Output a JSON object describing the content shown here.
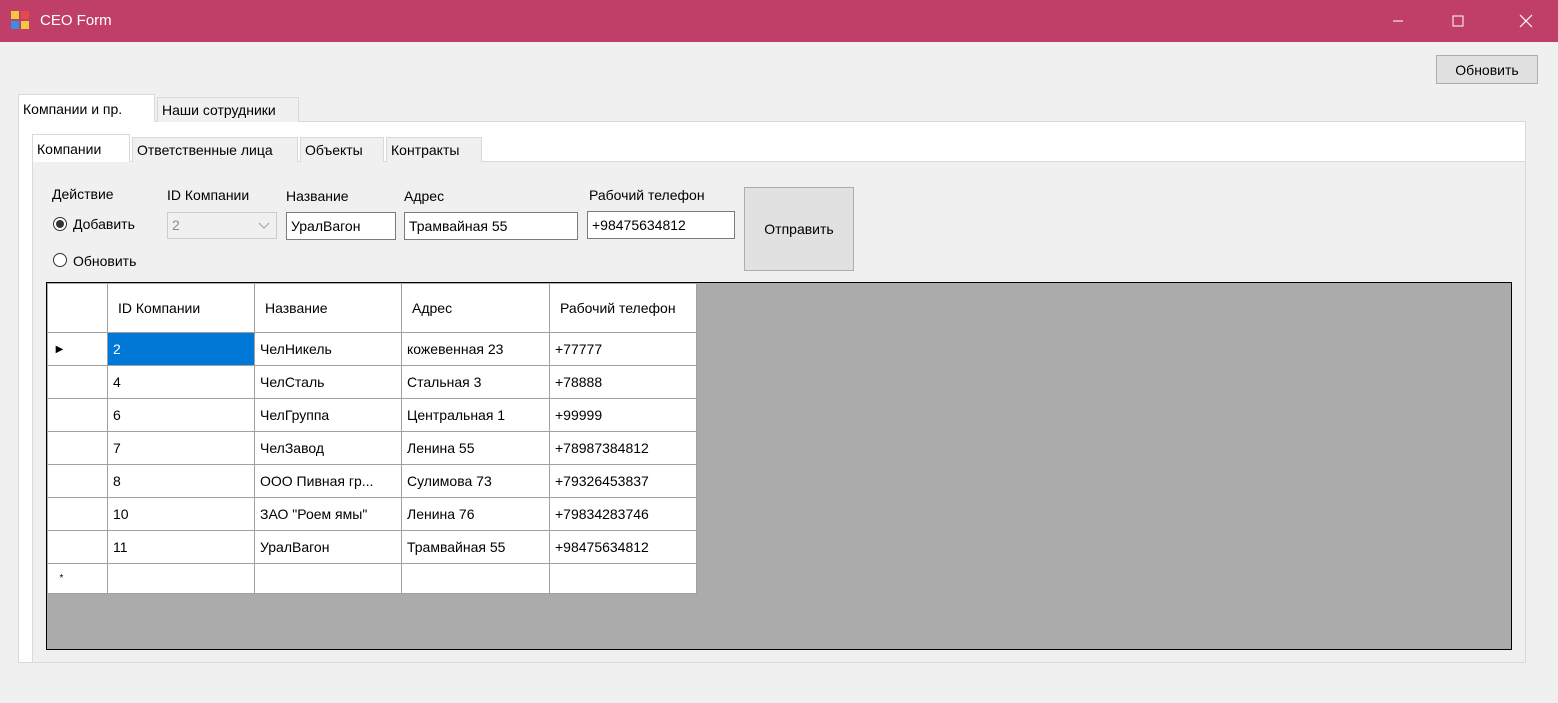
{
  "window": {
    "title": "CEO Form",
    "controls": {
      "minimize": "—",
      "maximize": "☐",
      "close": "✕"
    },
    "accent": "#bf3f69"
  },
  "toolbar": {
    "refresh_label": "Обновить"
  },
  "outer_tabs": [
    {
      "label": "Компании и пр.",
      "active": true
    },
    {
      "label": "Наши сотрудники",
      "active": false
    }
  ],
  "inner_tabs": [
    {
      "label": "Компании",
      "active": true
    },
    {
      "label": "Ответственные лица",
      "active": false
    },
    {
      "label": "Объекты",
      "active": false
    },
    {
      "label": "Контракты",
      "active": false
    }
  ],
  "form": {
    "action_label": "Действие",
    "radio_add": "Добавить",
    "radio_update": "Обновить",
    "selected_action": "add",
    "id_label": "ID Компании",
    "id_value": "2",
    "name_label": "Название",
    "name_value": "УралВагон",
    "address_label": "Адрес",
    "address_value": "Трамвайная 55",
    "phone_label": "Рабочий телефон",
    "phone_value": "+98475634812",
    "submit_label": "Отправить"
  },
  "grid": {
    "columns": [
      "ID Компании",
      "Название",
      "Адрес",
      "Рабочий телефон"
    ],
    "rows": [
      [
        "2",
        "ЧелНикель",
        "кожевенная 23",
        "+77777"
      ],
      [
        "4",
        "ЧелСталь",
        "Стальная 3",
        "+78888"
      ],
      [
        "6",
        "ЧелГруппа",
        "Центральная 1",
        "+99999"
      ],
      [
        "7",
        "ЧелЗавод",
        "Ленина 55",
        "+78987384812"
      ],
      [
        "8",
        "ООО Пивная гр...",
        "Сулимова 73",
        "+79326453837"
      ],
      [
        "10",
        "ЗАО \"Роем ямы\"",
        "Ленина 76",
        "+79834283746"
      ],
      [
        "11",
        "УралВагон",
        "Трамвайная 55",
        "+98475634812"
      ]
    ],
    "current_row_marker": "▶",
    "new_row_marker": "*",
    "selection_color": "#0078d7"
  }
}
